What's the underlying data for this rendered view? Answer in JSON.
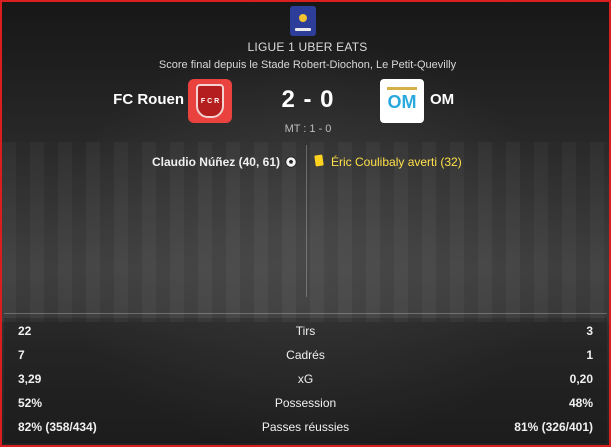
{
  "header": {
    "league": "LIGUE 1 UBER EATS",
    "venue": "Score final depuis le Stade Robert-Diochon, Le Petit-Quevilly"
  },
  "match": {
    "home_team": "FC Rouen",
    "away_team": "OM",
    "score": "2 - 0",
    "halftime": "MT : 1 - 0",
    "home_crest_text": "F C R",
    "away_crest_text": "OM"
  },
  "events": {
    "home": "Claudio Núñez (40, 61)",
    "away": "Éric Coulibaly averti (32)"
  },
  "stats": [
    {
      "label": "Tirs",
      "home": "22",
      "away": "3"
    },
    {
      "label": "Cadrés",
      "home": "7",
      "away": "1"
    },
    {
      "label": "xG",
      "home": "3,29",
      "away": "0,20"
    },
    {
      "label": "Possession",
      "home": "52%",
      "away": "48%"
    },
    {
      "label": "Passes réussies",
      "home": "82% (358/434)",
      "away": "81% (326/401)"
    }
  ],
  "colors": {
    "border": "#d81e1e",
    "card_yellow": "#ffd21f",
    "event_away_text": "#ffe04a"
  },
  "icons": {
    "league": "ligue1-logo",
    "goal": "soccer-ball-icon",
    "booking": "yellow-card-icon"
  }
}
